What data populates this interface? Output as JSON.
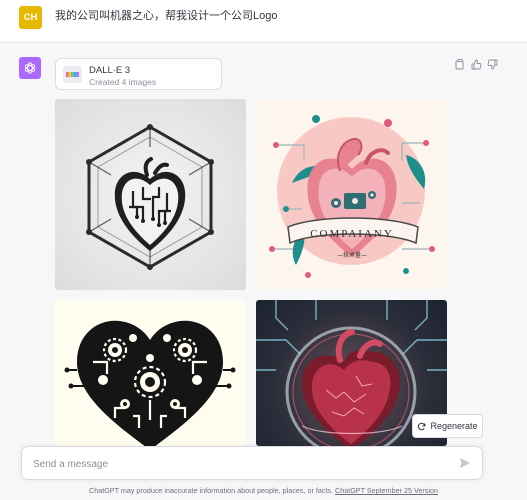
{
  "user_message": {
    "avatar_initials": "CH",
    "avatar_color": "#e6b800",
    "text": "我的公司叫机器之心，帮我设计一个公司Logo"
  },
  "assistant_message": {
    "avatar_icon": "openai-logo-icon",
    "avatar_color": "#ab68ff",
    "tool": {
      "name": "DALL·E 3",
      "status": "Created 4 images"
    },
    "images": [
      {
        "name": "geometric-circuit-heart-image"
      },
      {
        "name": "company-heart-emblem-image",
        "banner_text": "COMPAIANY",
        "sub_text": "—技术量—"
      },
      {
        "name": "gear-heart-image"
      },
      {
        "name": "neon-anatomical-heart-image"
      }
    ],
    "actions": [
      "copy-icon",
      "thumbs-up-icon",
      "thumbs-down-icon"
    ]
  },
  "regenerate_label": "Regenerate",
  "composer": {
    "placeholder": "Send a message"
  },
  "footer": {
    "text": "ChatGPT may produce inaccurate information about people, places, or facts. ",
    "link": "ChatGPT September 25 Version"
  }
}
